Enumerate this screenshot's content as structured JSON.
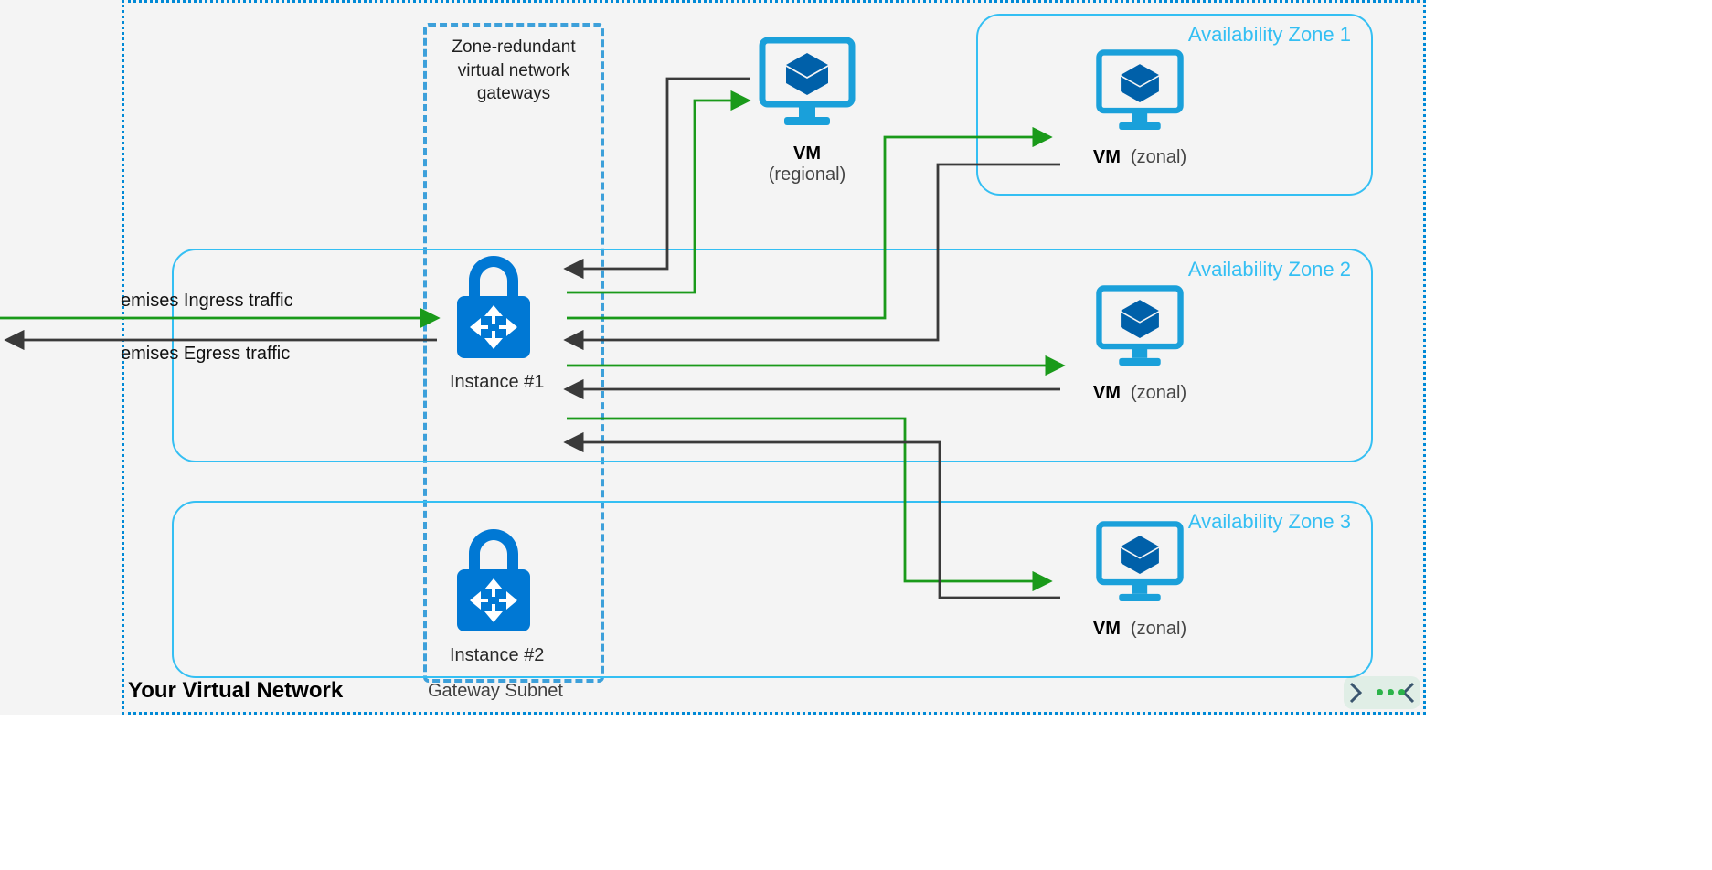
{
  "container": {
    "title": "Your Virtual Network"
  },
  "gatewaySubnet": {
    "label": "Gateway Subnet",
    "heading": "Zone-redundant\nvirtual network\ngateways"
  },
  "instances": {
    "i1": "Instance #1",
    "i2": "Instance #2"
  },
  "zones": {
    "z1": "Availability Zone 1",
    "z2": "Availability Zone 2",
    "z3": "Availability Zone 3"
  },
  "vms": {
    "regional": {
      "name": "VM",
      "type": "(regional)"
    },
    "z1": {
      "name": "VM",
      "type": "(zonal)"
    },
    "z2": {
      "name": "VM",
      "type": "(zonal)"
    },
    "z3": {
      "name": "VM",
      "type": "(zonal)"
    }
  },
  "traffic": {
    "ingress": "emises Ingress traffic",
    "egress": "emises Egress traffic"
  },
  "colors": {
    "ingress": "#1a9a1a",
    "egress": "#3a3a3a",
    "azureBlue": "#0078d4",
    "cyan": "#34bff3"
  }
}
